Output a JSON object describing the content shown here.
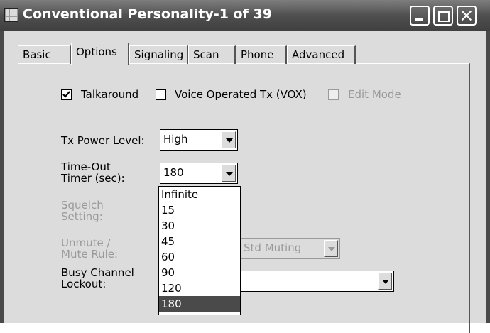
{
  "window": {
    "title": "Conventional Personality-1 of 39"
  },
  "tabs": [
    {
      "label": "Basic",
      "active": false
    },
    {
      "label": "Options",
      "active": true
    },
    {
      "label": "Signaling",
      "active": false
    },
    {
      "label": "Scan",
      "active": false
    },
    {
      "label": "Phone",
      "active": false
    },
    {
      "label": "Advanced",
      "active": false
    }
  ],
  "options": {
    "talkaround": {
      "label": "Talkaround",
      "checked": true
    },
    "vox": {
      "label": "Voice Operated Tx (VOX)",
      "checked": false
    },
    "edit_mode": {
      "label": "Edit Mode",
      "checked": false,
      "disabled": true
    },
    "tx_power": {
      "label": "Tx Power Level:",
      "value": "High"
    },
    "timeout": {
      "label_line1": "Time-Out",
      "label_line2": "Timer (sec):",
      "value": "180"
    },
    "squelch": {
      "label_line1": "Squelch",
      "label_line2": "Setting:",
      "disabled": true
    },
    "unmute": {
      "label_line1": "Unmute /",
      "label_line2": "Mute Rule:",
      "value": "Std Muting",
      "disabled": true
    },
    "busy": {
      "label_line1": "Busy Channel",
      "label_line2": "Lockout:",
      "value": ""
    }
  },
  "timeout_dropdown": {
    "options": [
      "Infinite",
      "15",
      "30",
      "45",
      "60",
      "90",
      "120",
      "180"
    ],
    "selected": "180"
  }
}
